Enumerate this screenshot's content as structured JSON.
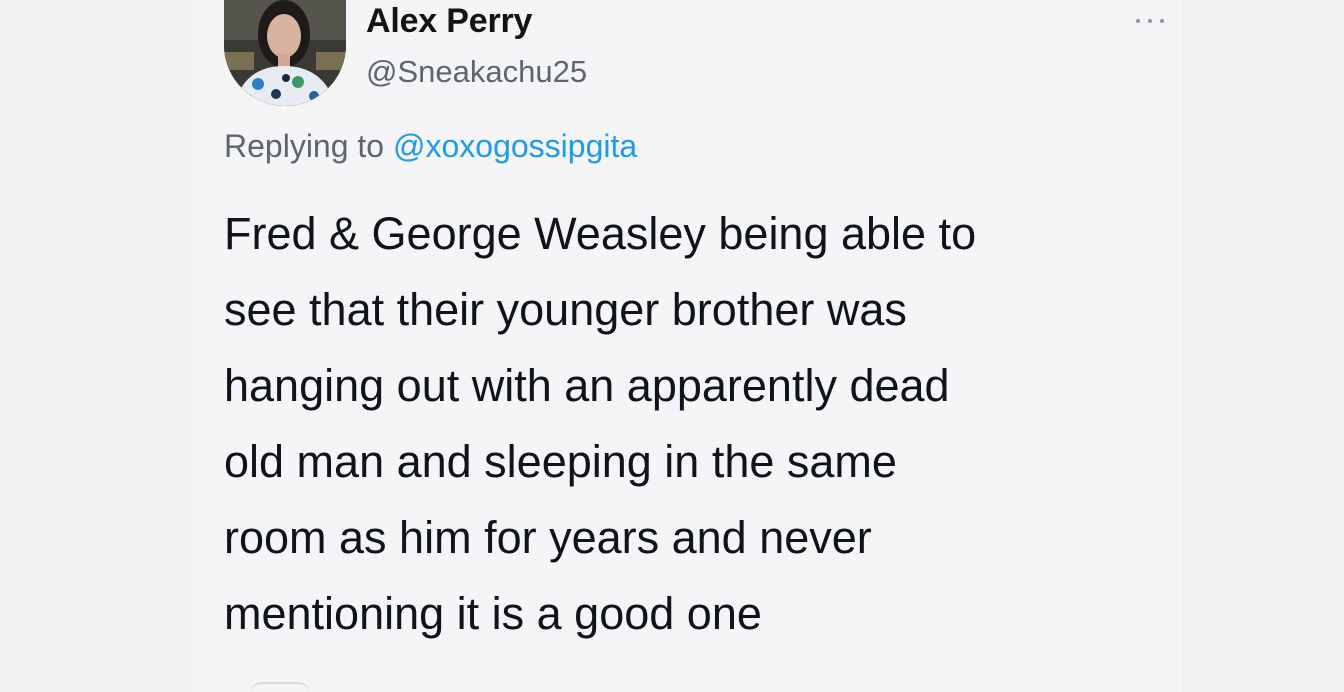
{
  "tweet": {
    "author": {
      "name": "Alex Perry",
      "handle": "@Sneakachu25",
      "avatar_icon": "profile-photo"
    },
    "more_icon": "more-dots-icon",
    "reply": {
      "prefix": "Replying to",
      "mention": "@xoxogossipgita"
    },
    "text_lines": [
      "Fred & George Weasley being able to",
      "see that their younger brother was",
      "hanging out with an apparently dead",
      "old man and sleeping in the same",
      "room as him for years and never",
      "mentioning it is a good one"
    ]
  },
  "colors": {
    "text": "#0f1419",
    "secondary": "#5d6670",
    "link": "#1d9bf0",
    "background": "#f5f5f7"
  }
}
